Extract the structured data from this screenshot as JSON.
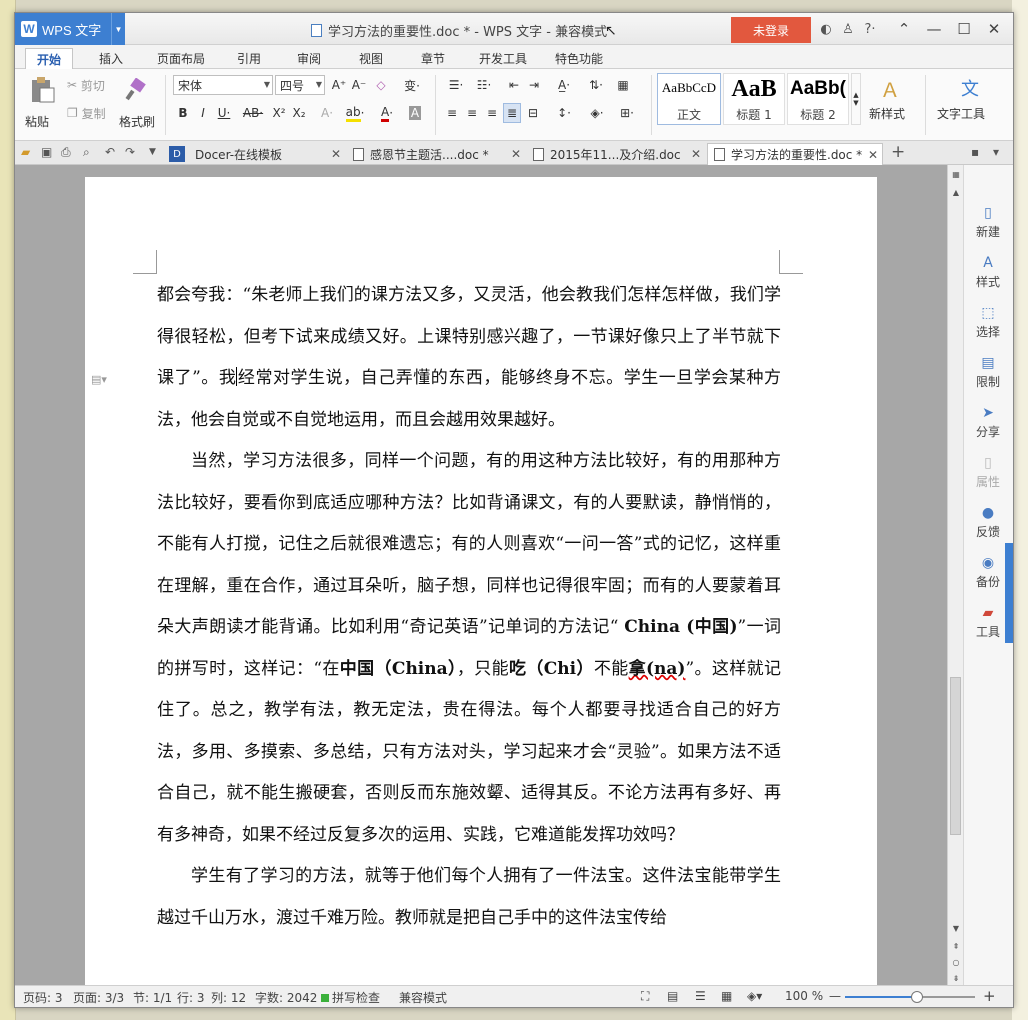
{
  "app": {
    "name": "WPS 文字",
    "doc_title": "学习方法的重要性.doc * - WPS 文字 - 兼容模式",
    "login_label": "未登录"
  },
  "menu_tabs": [
    "开始",
    "插入",
    "页面布局",
    "引用",
    "审阅",
    "视图",
    "章节",
    "开发工具",
    "特色功能"
  ],
  "ribbon": {
    "paste": "粘贴",
    "cut": "剪切",
    "copy": "复制",
    "format_painter": "格式刷",
    "font_name": "宋体",
    "font_size": "四号",
    "styles": [
      {
        "preview": "AaBbCcD",
        "name": "正文"
      },
      {
        "preview": "AaB",
        "name": "标题 1"
      },
      {
        "preview": "AaBb(",
        "name": "标题 2"
      }
    ],
    "new_style": "新样式",
    "text_tools": "文字工具"
  },
  "doc_tabs": [
    {
      "label": "Docer-在线模板",
      "active": false
    },
    {
      "label": "感恩节主题活....doc *",
      "active": false
    },
    {
      "label": "2015年11...及介绍.doc",
      "active": false
    },
    {
      "label": "学习方法的重要性.doc *",
      "active": true
    }
  ],
  "document": {
    "p1a": "都会夸我：“朱老师上我们的课方法又多，又灵活，他会教我们怎样怎样做，我们学得很轻松，但考下试来成绩又好。上课特别感兴趣了，一节课好像只上了半节就下课了”。我",
    "p1b": "经常对学生说，自己弄懂的东西，能够终身不忘。学生一旦学会某种方法，他会自觉或不自觉地运用，而且会越用效果越好。",
    "p2a": "当然，学习方法很多，同样一个问题，有的用这种方法比较好，有的用那种方法比较好，要看你到底适应哪种方法？比如背诵课文，有的人要默读，静悄悄的，不能有人打搅，记住之后就很难遗忘；有的人则喜欢“一问一答”式的记忆，这样重在理解，重在合作，通过耳朵听，脑子想，同样也记得很牢固；而有的人要蒙着耳朵大声朗读才能背诵。比如利用“奇记英语”记单词的方法记“ ",
    "p2b": "China (中国)",
    "p2c": "”一词的拼写时，这样记：“在",
    "p2d": "中国（China）",
    "p2e": "，只能",
    "p2f": "吃（Chi）",
    "p2g": "不能",
    "p2h": "拿(na)",
    "p2i": "”。这样就记住了。总之，教学有法，教无定法，贵在得法。每个人都要寻找适合自己的好方法，多用、多摸索、多总结，只有方法对头，学习起来才会“灵验”。如果方法不适合自己，就不能生搬硬套，否则反而东施效颦、适得其反。不论方法再有多好、再有多神奇，如果不经过反复多次的运用、实践，它难道能发挥功效吗？",
    "p3": "学生有了学习的方法，就等于他们每个人拥有了一件法宝。这件法宝能带学生越过千山万水，渡过千难万险。教师就是把自己手中的这件法宝传给"
  },
  "side_panel": [
    {
      "label": "新建",
      "icon": "new-doc-icon",
      "enabled": true
    },
    {
      "label": "样式",
      "icon": "style-icon",
      "enabled": true
    },
    {
      "label": "选择",
      "icon": "select-icon",
      "enabled": true
    },
    {
      "label": "限制",
      "icon": "restrict-icon",
      "enabled": true
    },
    {
      "label": "分享",
      "icon": "share-icon",
      "enabled": true
    },
    {
      "label": "属性",
      "icon": "properties-icon",
      "enabled": false
    },
    {
      "label": "反馈",
      "icon": "feedback-icon",
      "enabled": true
    },
    {
      "label": "备份",
      "icon": "backup-icon",
      "enabled": true
    },
    {
      "label": "工具",
      "icon": "tools-icon",
      "enabled": true
    }
  ],
  "status": {
    "page_no": "页码: 3",
    "pages": "页面: 3/3",
    "section": "节: 1/1",
    "row": "行: 3",
    "col": "列: 12",
    "words": "字数: 2042",
    "spell": "拼写检查",
    "compat": "兼容模式",
    "zoom": "100 %",
    "zoom_fraction": 0.55
  },
  "colors": {
    "accent": "#3d7fd1",
    "login": "#e2583e"
  }
}
